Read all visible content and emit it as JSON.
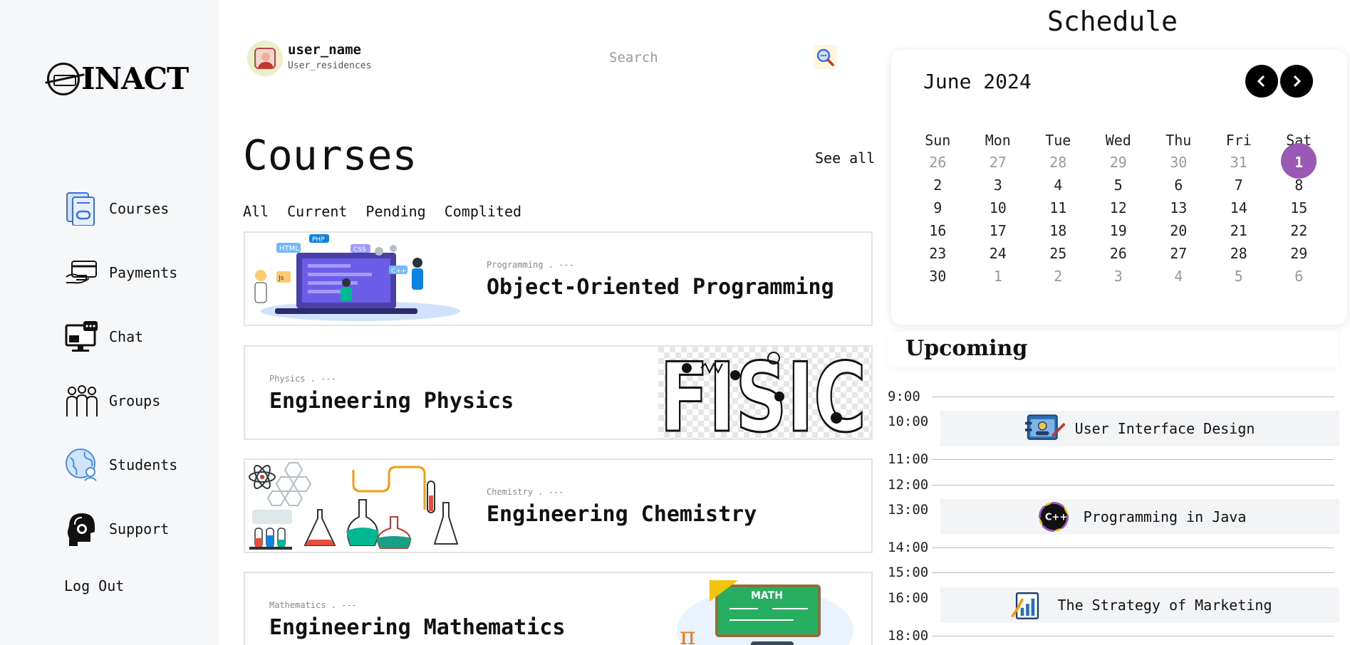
{
  "brand": {
    "logo_text": "INACT"
  },
  "sidebar": {
    "items": [
      {
        "label": "Courses",
        "icon": "courses-icon"
      },
      {
        "label": "Payments",
        "icon": "payments-icon"
      },
      {
        "label": "Chat",
        "icon": "chat-icon"
      },
      {
        "label": "Groups",
        "icon": "groups-icon"
      },
      {
        "label": "Students",
        "icon": "students-icon"
      },
      {
        "label": "Support",
        "icon": "support-icon"
      }
    ],
    "logout": "Log Out"
  },
  "header": {
    "user_name": "user_name",
    "user_sub": "User_residences",
    "search_placeholder": "Search"
  },
  "courses": {
    "title": "Courses",
    "see_all": "See all",
    "filters": [
      "All",
      "Current",
      "Pending",
      "Complited"
    ],
    "items": [
      {
        "meta": "Programming . ---",
        "title": "Object-Oriented Programming"
      },
      {
        "meta": "Physics . ---",
        "title": "Engineering Physics"
      },
      {
        "meta": "Chemistry . ---",
        "title": "Engineering Chemistry"
      },
      {
        "meta": "Mathematics . ---",
        "title": "Engineering Mathematics"
      }
    ]
  },
  "schedule": {
    "title": "Schedule",
    "month": "June 2024",
    "weekdays": [
      "Sun",
      "Mon",
      "Tue",
      "Wed",
      "Thu",
      "Fri",
      "Sat"
    ],
    "weeks": [
      [
        "26",
        "27",
        "28",
        "29",
        "30",
        "31",
        "1"
      ],
      [
        "2",
        "3",
        "4",
        "5",
        "6",
        "7",
        "8"
      ],
      [
        "9",
        "10",
        "11",
        "12",
        "13",
        "14",
        "15"
      ],
      [
        "16",
        "17",
        "18",
        "19",
        "20",
        "21",
        "22"
      ],
      [
        "23",
        "24",
        "25",
        "26",
        "27",
        "28",
        "29"
      ],
      [
        "30",
        "1",
        "2",
        "3",
        "4",
        "5",
        "6"
      ]
    ],
    "selected_day": "1",
    "accent": "#9b59b6"
  },
  "upcoming": {
    "title": "Upcoming",
    "times": [
      "9:00",
      "10:00",
      "11:00",
      "12:00",
      "13:00",
      "14:00",
      "15:00",
      "16:00",
      "18:00"
    ],
    "events": [
      {
        "label": "User Interface Design",
        "time": "10:00",
        "icon": "ui-design-icon"
      },
      {
        "label": "Programming in Java",
        "time": "13:00",
        "icon": "cpp-icon"
      },
      {
        "label": "The Strategy of Marketing",
        "time": "16:00",
        "icon": "marketing-chart-icon"
      }
    ]
  }
}
